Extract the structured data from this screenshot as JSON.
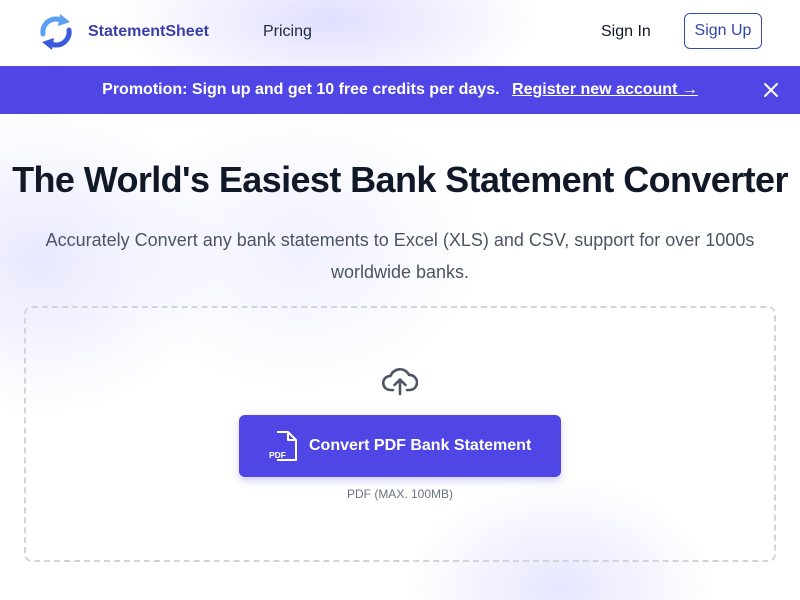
{
  "nav": {
    "brand": "StatementSheet",
    "links": [
      {
        "label": "Pricing"
      }
    ],
    "sign_in": "Sign In",
    "sign_up": "Sign Up"
  },
  "promo": {
    "text": "Promotion: Sign up and get 10 free credits per days.",
    "link": "Register new account →"
  },
  "hero": {
    "title": "The World's Easiest Bank Statement Converter",
    "subtitle": "Accurately Convert any bank statements to Excel (XLS) and CSV, support for over 1000s worldwide banks."
  },
  "upload": {
    "button_label": "Convert PDF Bank Statement",
    "pdf_icon_text": "PDF",
    "limit": "PDF (MAX. 100MB)"
  },
  "icons": {
    "logo": "refresh-arrows-icon",
    "close": "close-icon",
    "upload": "cloud-upload-icon",
    "file": "pdf-file-icon"
  },
  "colors": {
    "accent": "#4f46e5",
    "brand": "#3b3ea8",
    "logo_light": "#60a5fa",
    "logo_dark": "#3b5bdb"
  }
}
